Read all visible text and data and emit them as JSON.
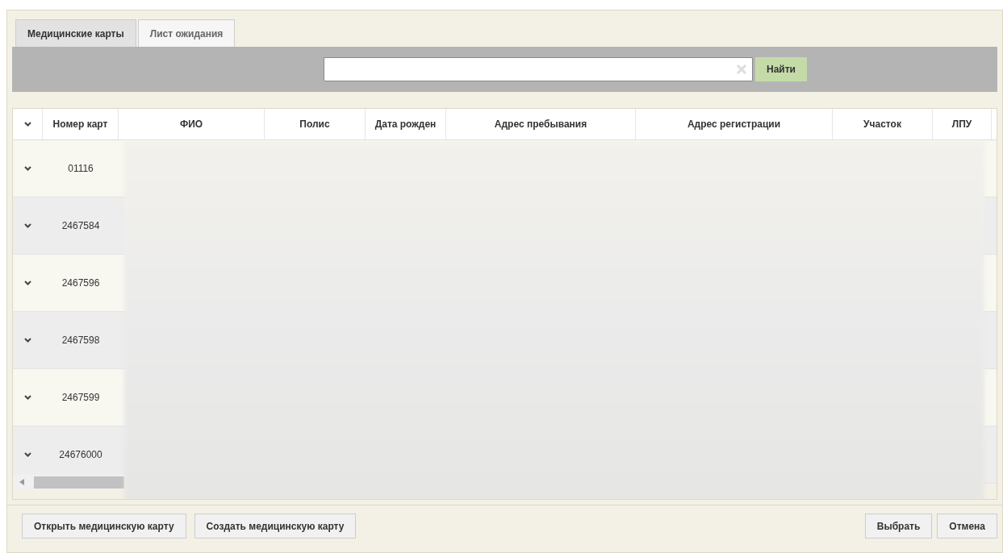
{
  "tabs": [
    {
      "label": "Медицинские карты",
      "selected": true
    },
    {
      "label": "Лист ожидания",
      "selected": false
    }
  ],
  "search": {
    "button": "Найти"
  },
  "table": {
    "columns": [
      "Номер карт",
      "ФИО",
      "Полис",
      "Дата рожден",
      "Адрес пребывания",
      "Адрес регистрации",
      "Участок",
      "ЛПУ"
    ],
    "rows": [
      {
        "number": "01116"
      },
      {
        "number": "2467584"
      },
      {
        "number": "2467596"
      },
      {
        "number": "2467598"
      },
      {
        "number": "2467599"
      },
      {
        "number": "24676000"
      }
    ]
  },
  "footer": {
    "left_buttons": [
      "Открыть медицинскую карту",
      "Создать медицинскую карту"
    ],
    "right_buttons": [
      "Выбрать",
      "Отмена"
    ]
  }
}
